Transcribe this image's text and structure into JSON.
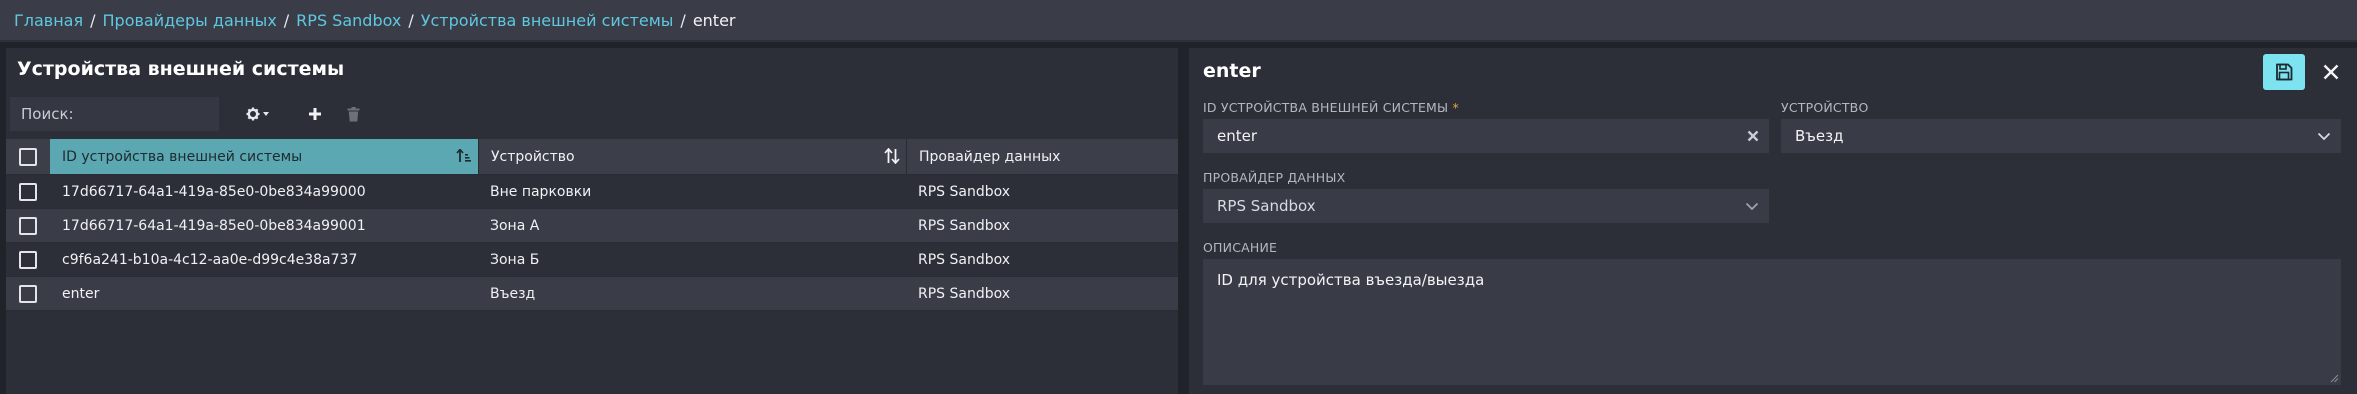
{
  "breadcrumb": {
    "items": [
      "Главная",
      "Провайдеры данных",
      "RPS Sandbox",
      "Устройства внешней системы"
    ],
    "current": "enter",
    "separator": "/"
  },
  "list": {
    "title": "Устройства внешней системы",
    "search_placeholder": "Поиск:",
    "columns": {
      "id": "ID устройства внешней системы",
      "device": "Устройство",
      "provider": "Провайдер данных"
    },
    "rows": [
      {
        "id": "17d66717-64a1-419a-85e0-0be834a99000",
        "device": "Вне парковки",
        "provider": "RPS Sandbox"
      },
      {
        "id": "17d66717-64a1-419a-85e0-0be834a99001",
        "device": "Зона А",
        "provider": "RPS Sandbox"
      },
      {
        "id": "c9f6a241-b10a-4c12-aa0e-d99c4e38a737",
        "device": "Зона Б",
        "provider": "RPS Sandbox"
      },
      {
        "id": "enter",
        "device": "Въезд",
        "provider": "RPS Sandbox"
      }
    ]
  },
  "detail": {
    "title": "enter",
    "id_label": "ID УСТРОЙСТВА ВНЕШНЕЙ СИСТЕМЫ",
    "required_mark": "*",
    "id_value": "enter",
    "device_label": "УСТРОЙСТВО",
    "device_value": "Въезд",
    "provider_label": "ПРОВАЙДЕР ДАННЫХ",
    "provider_value": "RPS Sandbox",
    "description_label": "ОПИСАНИЕ",
    "description_value": "ID для устройства въезда/выезда"
  },
  "icons": {
    "settings": "gear-icon",
    "add": "plus-icon",
    "delete": "trash-icon",
    "sort": "sort-icon",
    "save": "floppy-disk-icon",
    "close": "close-icon",
    "clear": "clear-x-icon",
    "dropdown": "chevron-down-icon"
  },
  "colors": {
    "accent": "#5ec8e0",
    "selected_header": "#5ba8b2",
    "save_button": "#7de3f0",
    "required": "#e8a33c"
  }
}
